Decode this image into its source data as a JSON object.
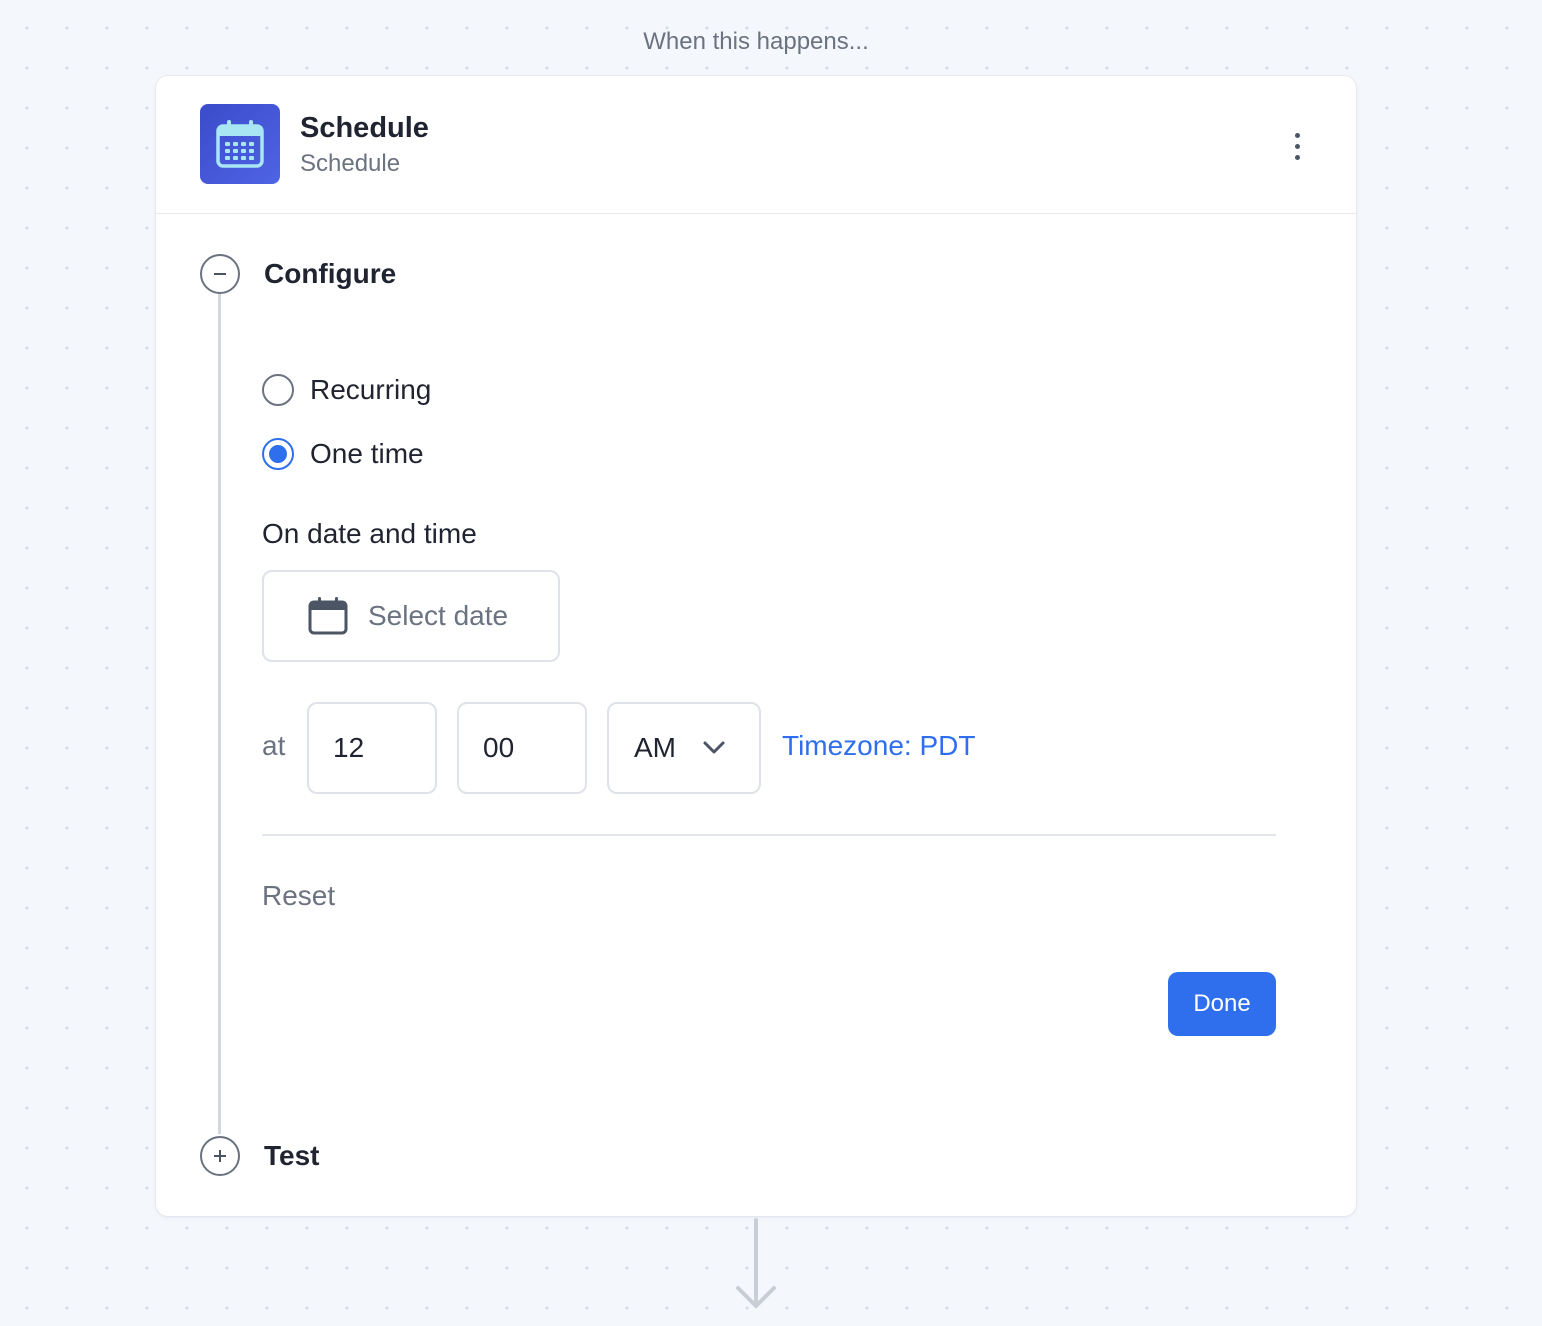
{
  "canvas": {
    "caption": "When this happens..."
  },
  "trigger": {
    "title": "Schedule",
    "subtitle": "Schedule",
    "icon": "calendar-icon",
    "icon_color": "#4357d8"
  },
  "steps": {
    "configure": {
      "title": "Configure",
      "expanded": true
    },
    "test": {
      "title": "Test",
      "expanded": false
    }
  },
  "schedule_type": {
    "options": [
      "Recurring",
      "One time"
    ],
    "selected": "One time"
  },
  "date_time": {
    "section_label": "On date and time",
    "date_placeholder": "Select date",
    "at_label": "at",
    "hour": "12",
    "minute": "00",
    "meridiem": "AM",
    "timezone_link": "Timezone: PDT"
  },
  "actions": {
    "reset_label": "Reset",
    "done_label": "Done"
  },
  "colors": {
    "accent": "#2f6fed",
    "muted_text": "#6b7280",
    "background": "#f4f7fc"
  }
}
